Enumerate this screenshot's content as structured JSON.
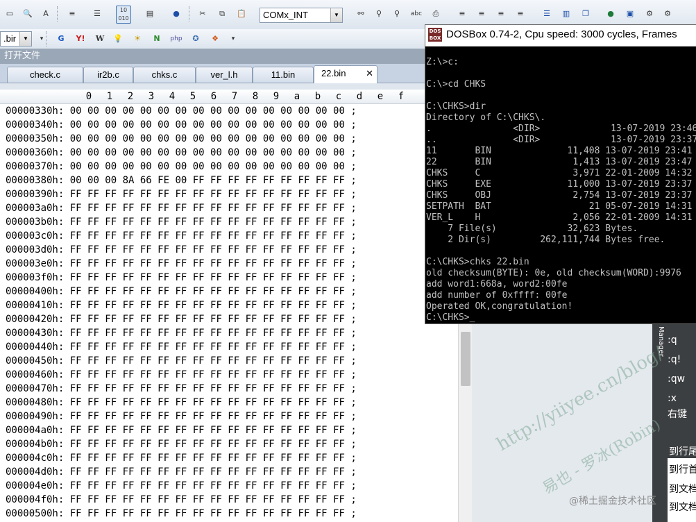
{
  "toolbar": {
    "encoding_combo": "COMx_INT",
    "file_combo": ".bir"
  },
  "panel": {
    "title": "打开文件"
  },
  "tabs": [
    {
      "label": "check.c"
    },
    {
      "label": "ir2b.c"
    },
    {
      "label": "chks.c"
    },
    {
      "label": "ver_l.h"
    },
    {
      "label": "11.bin"
    },
    {
      "label": "22.bin",
      "active": true
    }
  ],
  "hex": {
    "columns": [
      "0",
      "1",
      "2",
      "3",
      "4",
      "5",
      "6",
      "7",
      "8",
      "9",
      "a",
      "b",
      "c",
      "d",
      "e",
      "f"
    ],
    "rows": [
      {
        "addr": "00000330h:",
        "bytes": "00 00 00 00 00 00 00 00 00 00 00 00 00 00 00 00",
        "tail": ";"
      },
      {
        "addr": "00000340h:",
        "bytes": "00 00 00 00 00 00 00 00 00 00 00 00 00 00 00 00",
        "tail": ";"
      },
      {
        "addr": "00000350h:",
        "bytes": "00 00 00 00 00 00 00 00 00 00 00 00 00 00 00 00",
        "tail": ";"
      },
      {
        "addr": "00000360h:",
        "bytes": "00 00 00 00 00 00 00 00 00 00 00 00 00 00 00 00",
        "tail": ";"
      },
      {
        "addr": "00000370h:",
        "bytes": "00 00 00 00 00 00 00 00 00 00 00 00 00 00 00 00",
        "tail": ";"
      },
      {
        "addr": "00000380h:",
        "bytes": "00 00 00 8A 66 FE 00 FF FF FF FF FF FF FF FF FF",
        "tail": ";"
      },
      {
        "addr": "00000390h:",
        "bytes": "FF FF FF FF FF FF FF FF FF FF FF FF FF FF FF FF",
        "tail": ";"
      },
      {
        "addr": "000003a0h:",
        "bytes": "FF FF FF FF FF FF FF FF FF FF FF FF FF FF FF FF",
        "tail": ";"
      },
      {
        "addr": "000003b0h:",
        "bytes": "FF FF FF FF FF FF FF FF FF FF FF FF FF FF FF FF",
        "tail": ";"
      },
      {
        "addr": "000003c0h:",
        "bytes": "FF FF FF FF FF FF FF FF FF FF FF FF FF FF FF FF",
        "tail": ";"
      },
      {
        "addr": "000003d0h:",
        "bytes": "FF FF FF FF FF FF FF FF FF FF FF FF FF FF FF FF",
        "tail": ";"
      },
      {
        "addr": "000003e0h:",
        "bytes": "FF FF FF FF FF FF FF FF FF FF FF FF FF FF FF FF",
        "tail": ";"
      },
      {
        "addr": "000003f0h:",
        "bytes": "FF FF FF FF FF FF FF FF FF FF FF FF FF FF FF FF",
        "tail": ";"
      },
      {
        "addr": "00000400h:",
        "bytes": "FF FF FF FF FF FF FF FF FF FF FF FF FF FF FF FF",
        "tail": ";"
      },
      {
        "addr": "00000410h:",
        "bytes": "FF FF FF FF FF FF FF FF FF FF FF FF FF FF FF FF",
        "tail": ";"
      },
      {
        "addr": "00000420h:",
        "bytes": "FF FF FF FF FF FF FF FF FF FF FF FF FF FF FF FF",
        "tail": ";"
      },
      {
        "addr": "00000430h:",
        "bytes": "FF FF FF FF FF FF FF FF FF FF FF FF FF FF FF FF",
        "tail": ";"
      },
      {
        "addr": "00000440h:",
        "bytes": "FF FF FF FF FF FF FF FF FF FF FF FF FF FF FF FF",
        "tail": ";"
      },
      {
        "addr": "00000450h:",
        "bytes": "FF FF FF FF FF FF FF FF FF FF FF FF FF FF FF FF",
        "tail": ";"
      },
      {
        "addr": "00000460h:",
        "bytes": "FF FF FF FF FF FF FF FF FF FF FF FF FF FF FF FF",
        "tail": ";"
      },
      {
        "addr": "00000470h:",
        "bytes": "FF FF FF FF FF FF FF FF FF FF FF FF FF FF FF FF",
        "tail": ";"
      },
      {
        "addr": "00000480h:",
        "bytes": "FF FF FF FF FF FF FF FF FF FF FF FF FF FF FF FF",
        "tail": ";"
      },
      {
        "addr": "00000490h:",
        "bytes": "FF FF FF FF FF FF FF FF FF FF FF FF FF FF FF FF",
        "tail": ";"
      },
      {
        "addr": "000004a0h:",
        "bytes": "FF FF FF FF FF FF FF FF FF FF FF FF FF FF FF FF",
        "tail": ";"
      },
      {
        "addr": "000004b0h:",
        "bytes": "FF FF FF FF FF FF FF FF FF FF FF FF FF FF FF FF",
        "tail": ";"
      },
      {
        "addr": "000004c0h:",
        "bytes": "FF FF FF FF FF FF FF FF FF FF FF FF FF FF FF FF",
        "tail": ";"
      },
      {
        "addr": "000004d0h:",
        "bytes": "FF FF FF FF FF FF FF FF FF FF FF FF FF FF FF FF",
        "tail": ";"
      },
      {
        "addr": "000004e0h:",
        "bytes": "FF FF FF FF FF FF FF FF FF FF FF FF FF FF FF FF",
        "tail": ";"
      },
      {
        "addr": "000004f0h:",
        "bytes": "FF FF FF FF FF FF FF FF FF FF FF FF FF FF FF FF",
        "tail": ";"
      },
      {
        "addr": "00000500h:",
        "bytes": "FF FF FF FF FF FF FF FF FF FF FF FF FF FF FF FF",
        "tail": ";"
      }
    ]
  },
  "dosbox": {
    "title": "DOSBox 0.74-2, Cpu speed:     3000 cycles, Frames",
    "icon_text": "DOS BOX",
    "lines": [
      "Z:\\>c:",
      "",
      "C:\\>cd CHKS",
      "",
      "C:\\CHKS>dir",
      "Directory of C:\\CHKS\\.",
      ".               <DIR>             13-07-2019 23:46",
      "..              <DIR>             13-07-2019 23:37",
      "11       BIN              11,408 13-07-2019 23:41",
      "22       BIN               1,413 13-07-2019 23:47",
      "CHKS     C                 3,971 22-01-2009 14:32",
      "CHKS     EXE              11,000 13-07-2019 23:37",
      "CHKS     OBJ               2,754 13-07-2019 23:37",
      "SETPATH  BAT                  21 05-07-2019 14:31",
      "VER_L    H                 2,056 22-01-2009 14:31",
      "    7 File(s)             32,623 Bytes.",
      "    2 Dir(s)         262,111,744 Bytes free.",
      "",
      "C:\\CHKS>chks 22.bin",
      "old checksum(BYTE): 0e, old checksum(WORD):9976",
      "add word1:668a, word2:00fe",
      "add number of 0xffff: 00fe",
      "Operated OK,congratulation!",
      "C:\\CHKS>_"
    ]
  },
  "right_panel": {
    "vertical_label": "Manager",
    "items": [
      ":q",
      ":q!",
      ":qw",
      ":x",
      "右键"
    ],
    "lower_items": [
      "到行尾",
      "到行首",
      "到文档",
      "到文档"
    ]
  },
  "watermark": {
    "line1": "http://yiiyee.cn/blog/",
    "line2": "易也 - 罗冰(Robin)"
  },
  "credit": "@稀土掘金技术社区"
}
